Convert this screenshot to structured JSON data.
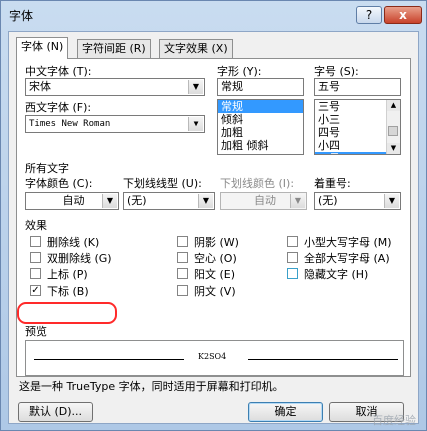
{
  "window": {
    "title": "字体",
    "help": "?",
    "close": "x"
  },
  "tabs": [
    "字体 (N)",
    "字符间距 (R)",
    "文字效果 (X)"
  ],
  "labels": {
    "cn_font": "中文字体 (T):",
    "west_font": "西文字体 (F):",
    "style": "字形 (Y):",
    "size": "字号 (S):",
    "all_text": "所有文字",
    "font_color": "字体颜色 (C):",
    "underline_type": "下划线线型 (U):",
    "underline_color": "下划线颜色 (I):",
    "emphasis": "着重号:",
    "effects": "效果",
    "preview": "预览"
  },
  "values": {
    "cn_font": "宋体",
    "west_font": "Times New Roman",
    "style": "常规",
    "size": "五号",
    "font_color": "自动",
    "underline_type": "(无)",
    "underline_color": "自动",
    "emphasis": "(无)"
  },
  "style_list": [
    "常规",
    "倾斜",
    "加粗",
    "加粗 倾斜"
  ],
  "size_list": [
    "三号",
    "小三",
    "四号",
    "小四",
    "五号"
  ],
  "effects": {
    "col1": [
      "删除线 (K)",
      "双删除线 (G)",
      "上标 (P)",
      "下标 (B)"
    ],
    "col2": [
      "阴影 (W)",
      "空心 (O)",
      "阳文 (E)",
      "阴文 (V)"
    ],
    "col3": [
      "小型大写字母 (M)",
      "全部大写字母 (A)",
      "隐藏文字 (H)"
    ]
  },
  "checked": {
    "subscript": "✓"
  },
  "preview_text": "K2SO4",
  "info": "这是一种 TrueType 字体，同时适用于屏幕和打印机。",
  "buttons": {
    "default": "默认 (D)...",
    "ok": "确定",
    "cancel": "取消"
  },
  "watermark": "百度经验"
}
